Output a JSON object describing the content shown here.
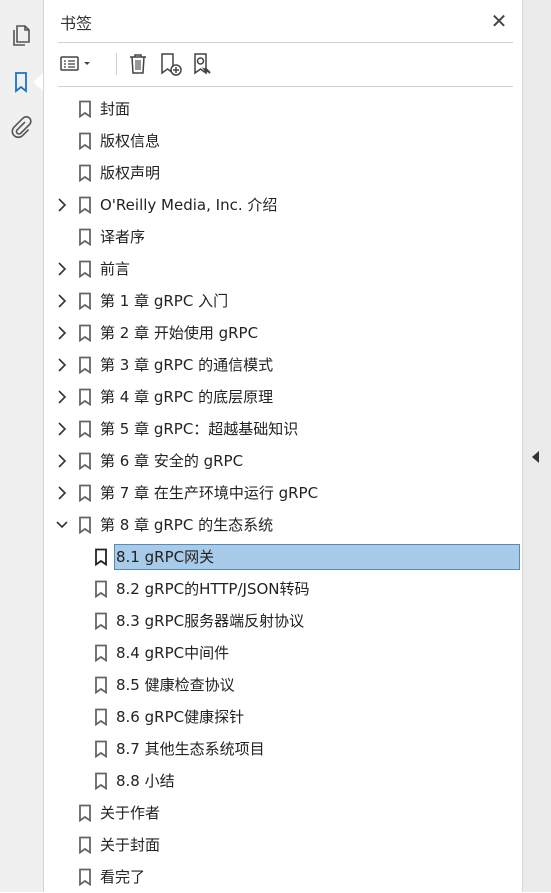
{
  "panel": {
    "title": "书签",
    "close_glyph": "✕"
  },
  "rail": {
    "items": [
      {
        "name": "pages-icon"
      },
      {
        "name": "bookmark-icon",
        "active": true
      },
      {
        "name": "paperclip-icon"
      }
    ]
  },
  "colors": {
    "accent": "#1a73c8",
    "selection_bg": "#a8cbe9",
    "selection_border": "#5a8ab8",
    "icon": "#555555"
  },
  "bookmarks": [
    {
      "label": "封面",
      "level": 0,
      "expander": "none"
    },
    {
      "label": "版权信息",
      "level": 0,
      "expander": "none"
    },
    {
      "label": "版权声明",
      "level": 0,
      "expander": "none"
    },
    {
      "label": "O'Reilly Media, Inc. 介绍",
      "level": 0,
      "expander": "collapsed"
    },
    {
      "label": "译者序",
      "level": 0,
      "expander": "none"
    },
    {
      "label": "前言",
      "level": 0,
      "expander": "collapsed"
    },
    {
      "label": "第 1 章 gRPC 入门",
      "level": 0,
      "expander": "collapsed"
    },
    {
      "label": "第 2 章 开始使用 gRPC",
      "level": 0,
      "expander": "collapsed"
    },
    {
      "label": "第 3 章 gRPC 的通信模式",
      "level": 0,
      "expander": "collapsed"
    },
    {
      "label": "第 4 章 gRPC 的底层原理",
      "level": 0,
      "expander": "collapsed"
    },
    {
      "label": "第 5 章 gRPC：超越基础知识",
      "level": 0,
      "expander": "collapsed"
    },
    {
      "label": "第 6 章 安全的 gRPC",
      "level": 0,
      "expander": "collapsed"
    },
    {
      "label": "第 7 章 在生产环境中运行 gRPC",
      "level": 0,
      "expander": "collapsed"
    },
    {
      "label": "第 8 章 gRPC 的生态系统",
      "level": 0,
      "expander": "expanded"
    },
    {
      "label": "8.1 gRPC网关",
      "level": 1,
      "expander": "none",
      "selected": true
    },
    {
      "label": "8.2 gRPC的HTTP/JSON转码",
      "level": 1,
      "expander": "none"
    },
    {
      "label": "8.3 gRPC服务器端反射协议",
      "level": 1,
      "expander": "none"
    },
    {
      "label": "8.4 gRPC中间件",
      "level": 1,
      "expander": "none"
    },
    {
      "label": "8.5 健康检查协议",
      "level": 1,
      "expander": "none"
    },
    {
      "label": "8.6 gRPC健康探针",
      "level": 1,
      "expander": "none"
    },
    {
      "label": "8.7 其他生态系统项目",
      "level": 1,
      "expander": "none"
    },
    {
      "label": "8.8 小结",
      "level": 1,
      "expander": "none"
    },
    {
      "label": "关于作者",
      "level": 0,
      "expander": "none"
    },
    {
      "label": "关于封面",
      "level": 0,
      "expander": "none"
    },
    {
      "label": "看完了",
      "level": 0,
      "expander": "none"
    }
  ]
}
